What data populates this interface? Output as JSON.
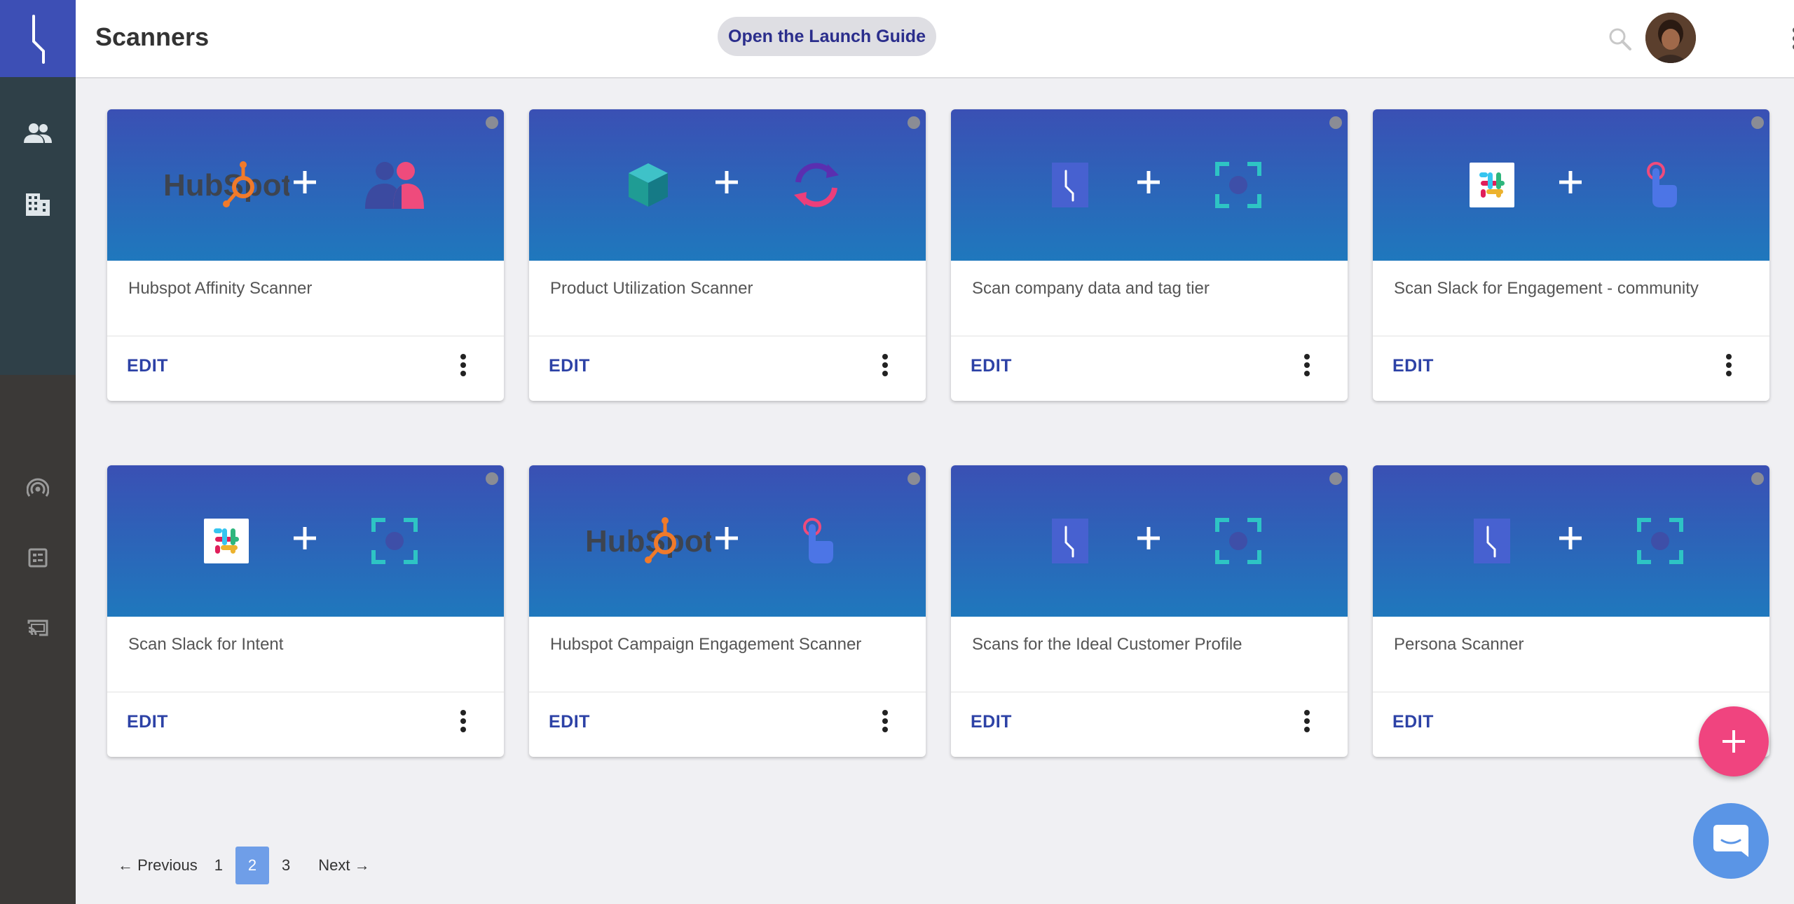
{
  "header": {
    "title": "Scanners",
    "guide_button": "Open the Launch Guide"
  },
  "sidebar": {
    "items": [
      {
        "icon": "people-icon"
      },
      {
        "icon": "building-icon"
      },
      {
        "icon": "signal-icon"
      },
      {
        "icon": "dashboard-icon"
      },
      {
        "icon": "cast-icon"
      }
    ]
  },
  "cards": [
    {
      "title": "Hubspot Affinity Scanner",
      "edit": "EDIT",
      "left_logo": "hubspot-logo",
      "right_logo": "people-group-icon"
    },
    {
      "title": "Product Utilization Scanner",
      "edit": "EDIT",
      "left_logo": "cube-icon",
      "right_logo": "sync-icon"
    },
    {
      "title": "Scan company data and tag tier",
      "edit": "EDIT",
      "left_logo": "app-logo",
      "right_logo": "scan-focus-icon"
    },
    {
      "title": "Scan Slack for Engagement - community",
      "edit": "EDIT",
      "left_logo": "slack-logo",
      "right_logo": "touch-icon"
    },
    {
      "title": "Scan Slack for Intent",
      "edit": "EDIT",
      "left_logo": "slack-logo",
      "right_logo": "scan-focus-icon"
    },
    {
      "title": "Hubspot Campaign Engagement Scanner",
      "edit": "EDIT",
      "left_logo": "hubspot-logo",
      "right_logo": "touch-icon"
    },
    {
      "title": "Scans for the Ideal Customer Profile",
      "edit": "EDIT",
      "left_logo": "app-logo",
      "right_logo": "scan-focus-icon"
    },
    {
      "title": "Persona Scanner",
      "edit": "EDIT",
      "left_logo": "app-logo",
      "right_logo": "scan-focus-icon"
    }
  ],
  "logo_text": {
    "hubspot": "HubSpot"
  },
  "pagination": {
    "previous": "← Previous",
    "pages": [
      "1",
      "2",
      "3"
    ],
    "current": "2",
    "next": "Next →"
  },
  "colors": {
    "accent": "#3d4fb5",
    "banner_top": "#3a50b4",
    "banner_bottom": "#1f78bd",
    "fab": "#f0447f",
    "chat": "#5a95e6",
    "edit_text": "#2d42a6",
    "pager_active": "#6f9ee8"
  }
}
